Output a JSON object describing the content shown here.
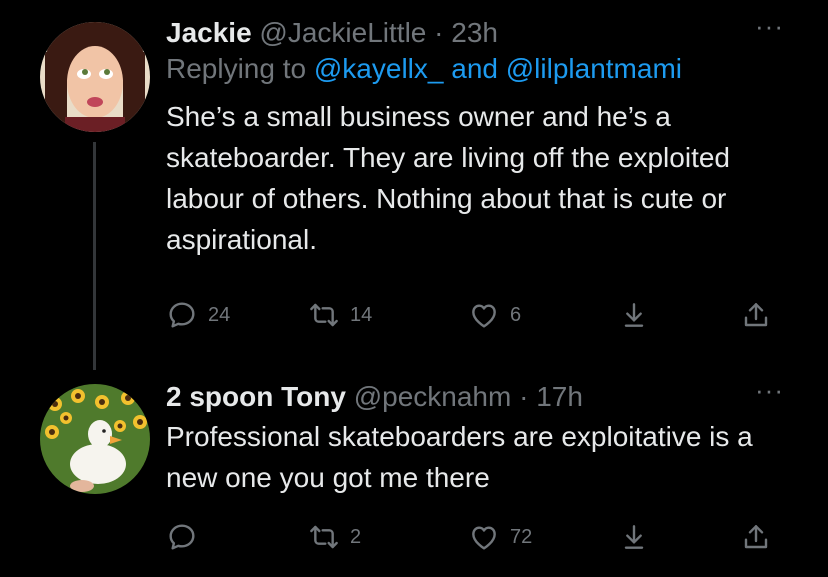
{
  "tweets": [
    {
      "name": "Jackie",
      "handle": "@JackieLittle",
      "separator": "·",
      "time": "23h",
      "more": "···",
      "replying_prefix": "Replying to ",
      "mention_1": "@kayellx_",
      "replying_and": " and ",
      "mention_2": "@lilplantmami",
      "text": "She’s a small business owner and he’s a skateboarder. They are living off the exploited labour of others. Nothing about that is cute or aspirational.",
      "replies": "24",
      "retweets": "14",
      "likes": "6"
    },
    {
      "name": "2 spoon Tony",
      "handle": "@pecknahm",
      "separator": "·",
      "time": "17h",
      "more": "···",
      "text": "Professional skateboarders are exploitative is a new one you got me there",
      "replies": "",
      "retweets": "2",
      "likes": "72"
    }
  ],
  "icons": [
    "reply-icon",
    "retweet-icon",
    "like-icon",
    "bookmark-icon",
    "share-icon",
    "more-icon"
  ],
  "colors": {
    "background": "#000000",
    "text": "#e7e9ea",
    "secondary": "#71767b",
    "link": "#1d9bf0",
    "thread_line": "#333639"
  }
}
